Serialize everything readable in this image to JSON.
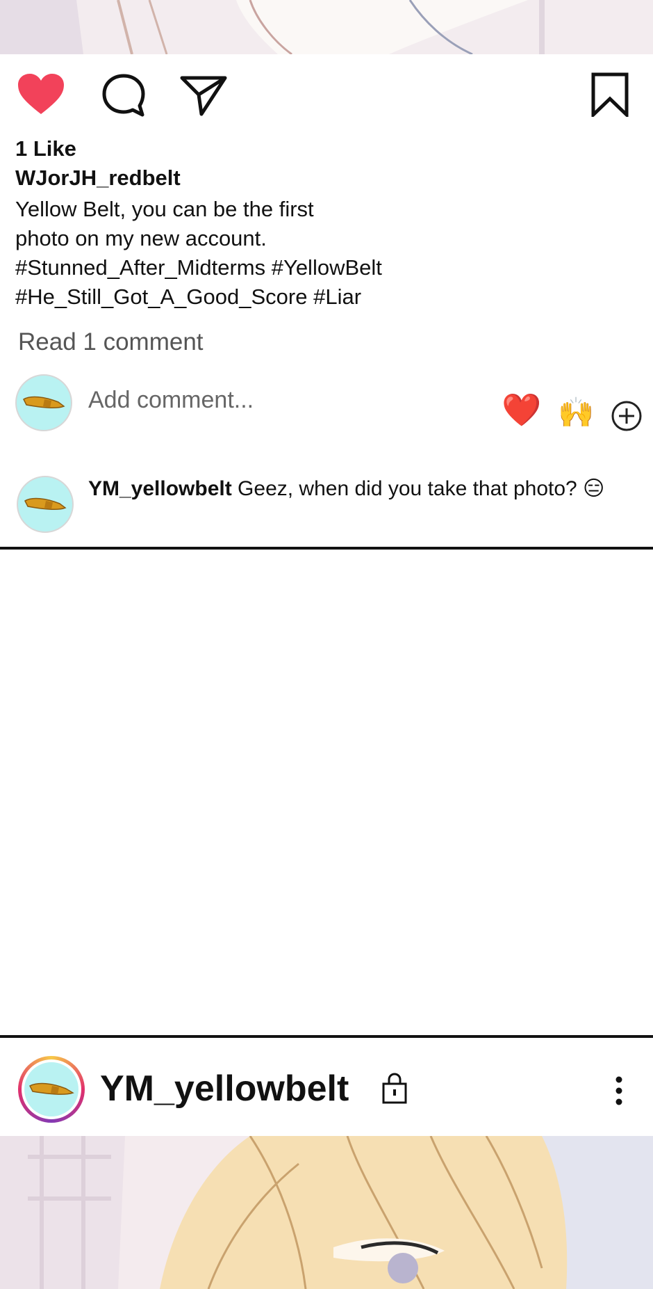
{
  "post1": {
    "actions": {
      "like_icon": "heart-filled-icon",
      "comment_icon": "speech-bubble-icon",
      "share_icon": "paper-plane-icon",
      "save_icon": "bookmark-icon",
      "like_color": "#f2425a"
    },
    "likes_text": "1 Like",
    "author": "WJorJH_redbelt",
    "caption_lines": [
      "Yellow Belt, you can be the first",
      "photo on my new account.",
      "#Stunned_After_Midterms #YellowBelt",
      "#He_Still_Got_A_Good_Score #Liar"
    ],
    "read_comments": "Read 1 comment",
    "add_comment": {
      "placeholder": "Add comment...",
      "quick_reactions": [
        "❤️",
        "🙌"
      ],
      "more_icon": "plus-circle-icon"
    },
    "comment": {
      "username": "YM_yellowbelt",
      "text": " Geez, when did you take that photo? 😑"
    }
  },
  "post2": {
    "username": "YM_yellowbelt",
    "lock_icon": "padlock-icon",
    "menu_icon": "vertical-dots-icon",
    "story_ring_colors": [
      "#f7c948",
      "#e1306c",
      "#833ab4"
    ]
  },
  "colors": {
    "avatar_bg": "#b9f2f2",
    "belt": "#d99a1e",
    "divider": "#111111"
  }
}
